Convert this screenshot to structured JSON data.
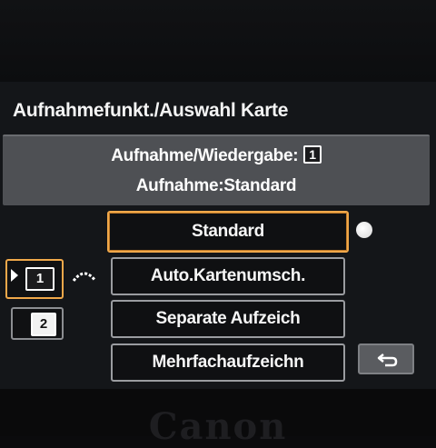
{
  "brand": "Canon",
  "header": {
    "title": "Aufnahmefunkt./Auswahl Karte"
  },
  "info": {
    "line1": "Aufnahme/Wiedergabe:",
    "line1_slot": "1",
    "line2": "Aufnahme:Standard"
  },
  "options": [
    {
      "label": "Standard",
      "selected": true
    },
    {
      "label": "Auto.Kartenumsch.",
      "selected": false
    },
    {
      "label": "Separate Aufzeich",
      "selected": false
    },
    {
      "label": "Mehrfachaufzeichn",
      "selected": false
    }
  ],
  "card_slots": [
    {
      "label": "1",
      "selected": true
    },
    {
      "label": "2",
      "selected": false
    }
  ],
  "icons": {
    "set_indicator": "set-dot-icon",
    "card_relay": "card-relay-icon",
    "back": "back-arrow-icon",
    "selection_arrow": "triangle-right-icon"
  },
  "colors": {
    "accent": "#f0a84a",
    "panel": "#4e5054",
    "screen_bg": "#141619"
  }
}
